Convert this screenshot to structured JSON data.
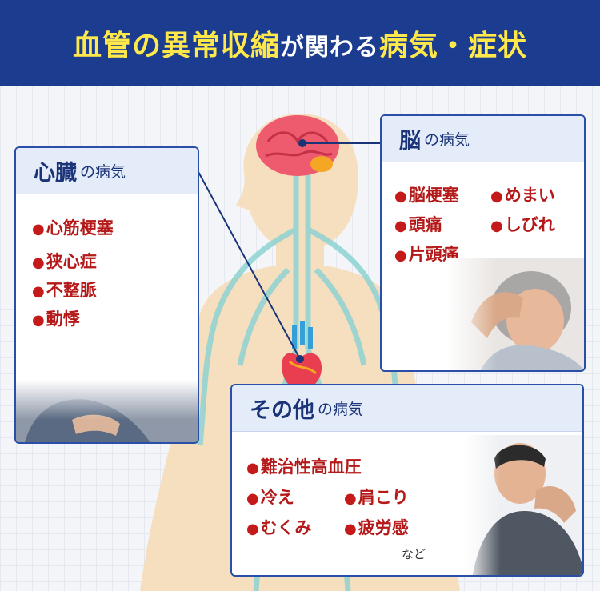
{
  "banner": {
    "title_part1": "血管の異常収縮",
    "title_part2": "が関わる",
    "title_part3": "病気・症状"
  },
  "heart_card": {
    "title": "心臓",
    "suffix": "の病気",
    "items": [
      "心筋梗塞",
      "狭心症",
      "不整脈",
      "動悸"
    ]
  },
  "brain_card": {
    "title": "脳",
    "suffix": "の病気",
    "items": [
      "脳梗塞",
      "めまい",
      "頭痛",
      "しびれ",
      "片頭痛"
    ]
  },
  "other_card": {
    "title": "その他",
    "suffix": "の病気",
    "items": [
      "難治性高血圧",
      "冷え",
      "肩こり",
      "むくみ",
      "疲労感"
    ],
    "note": "など"
  },
  "colors": {
    "banner_bg": "#1c3d8f",
    "banner_text": "#ffe94a",
    "card_border": "#2a4fa8",
    "item_text": "#b41818"
  }
}
